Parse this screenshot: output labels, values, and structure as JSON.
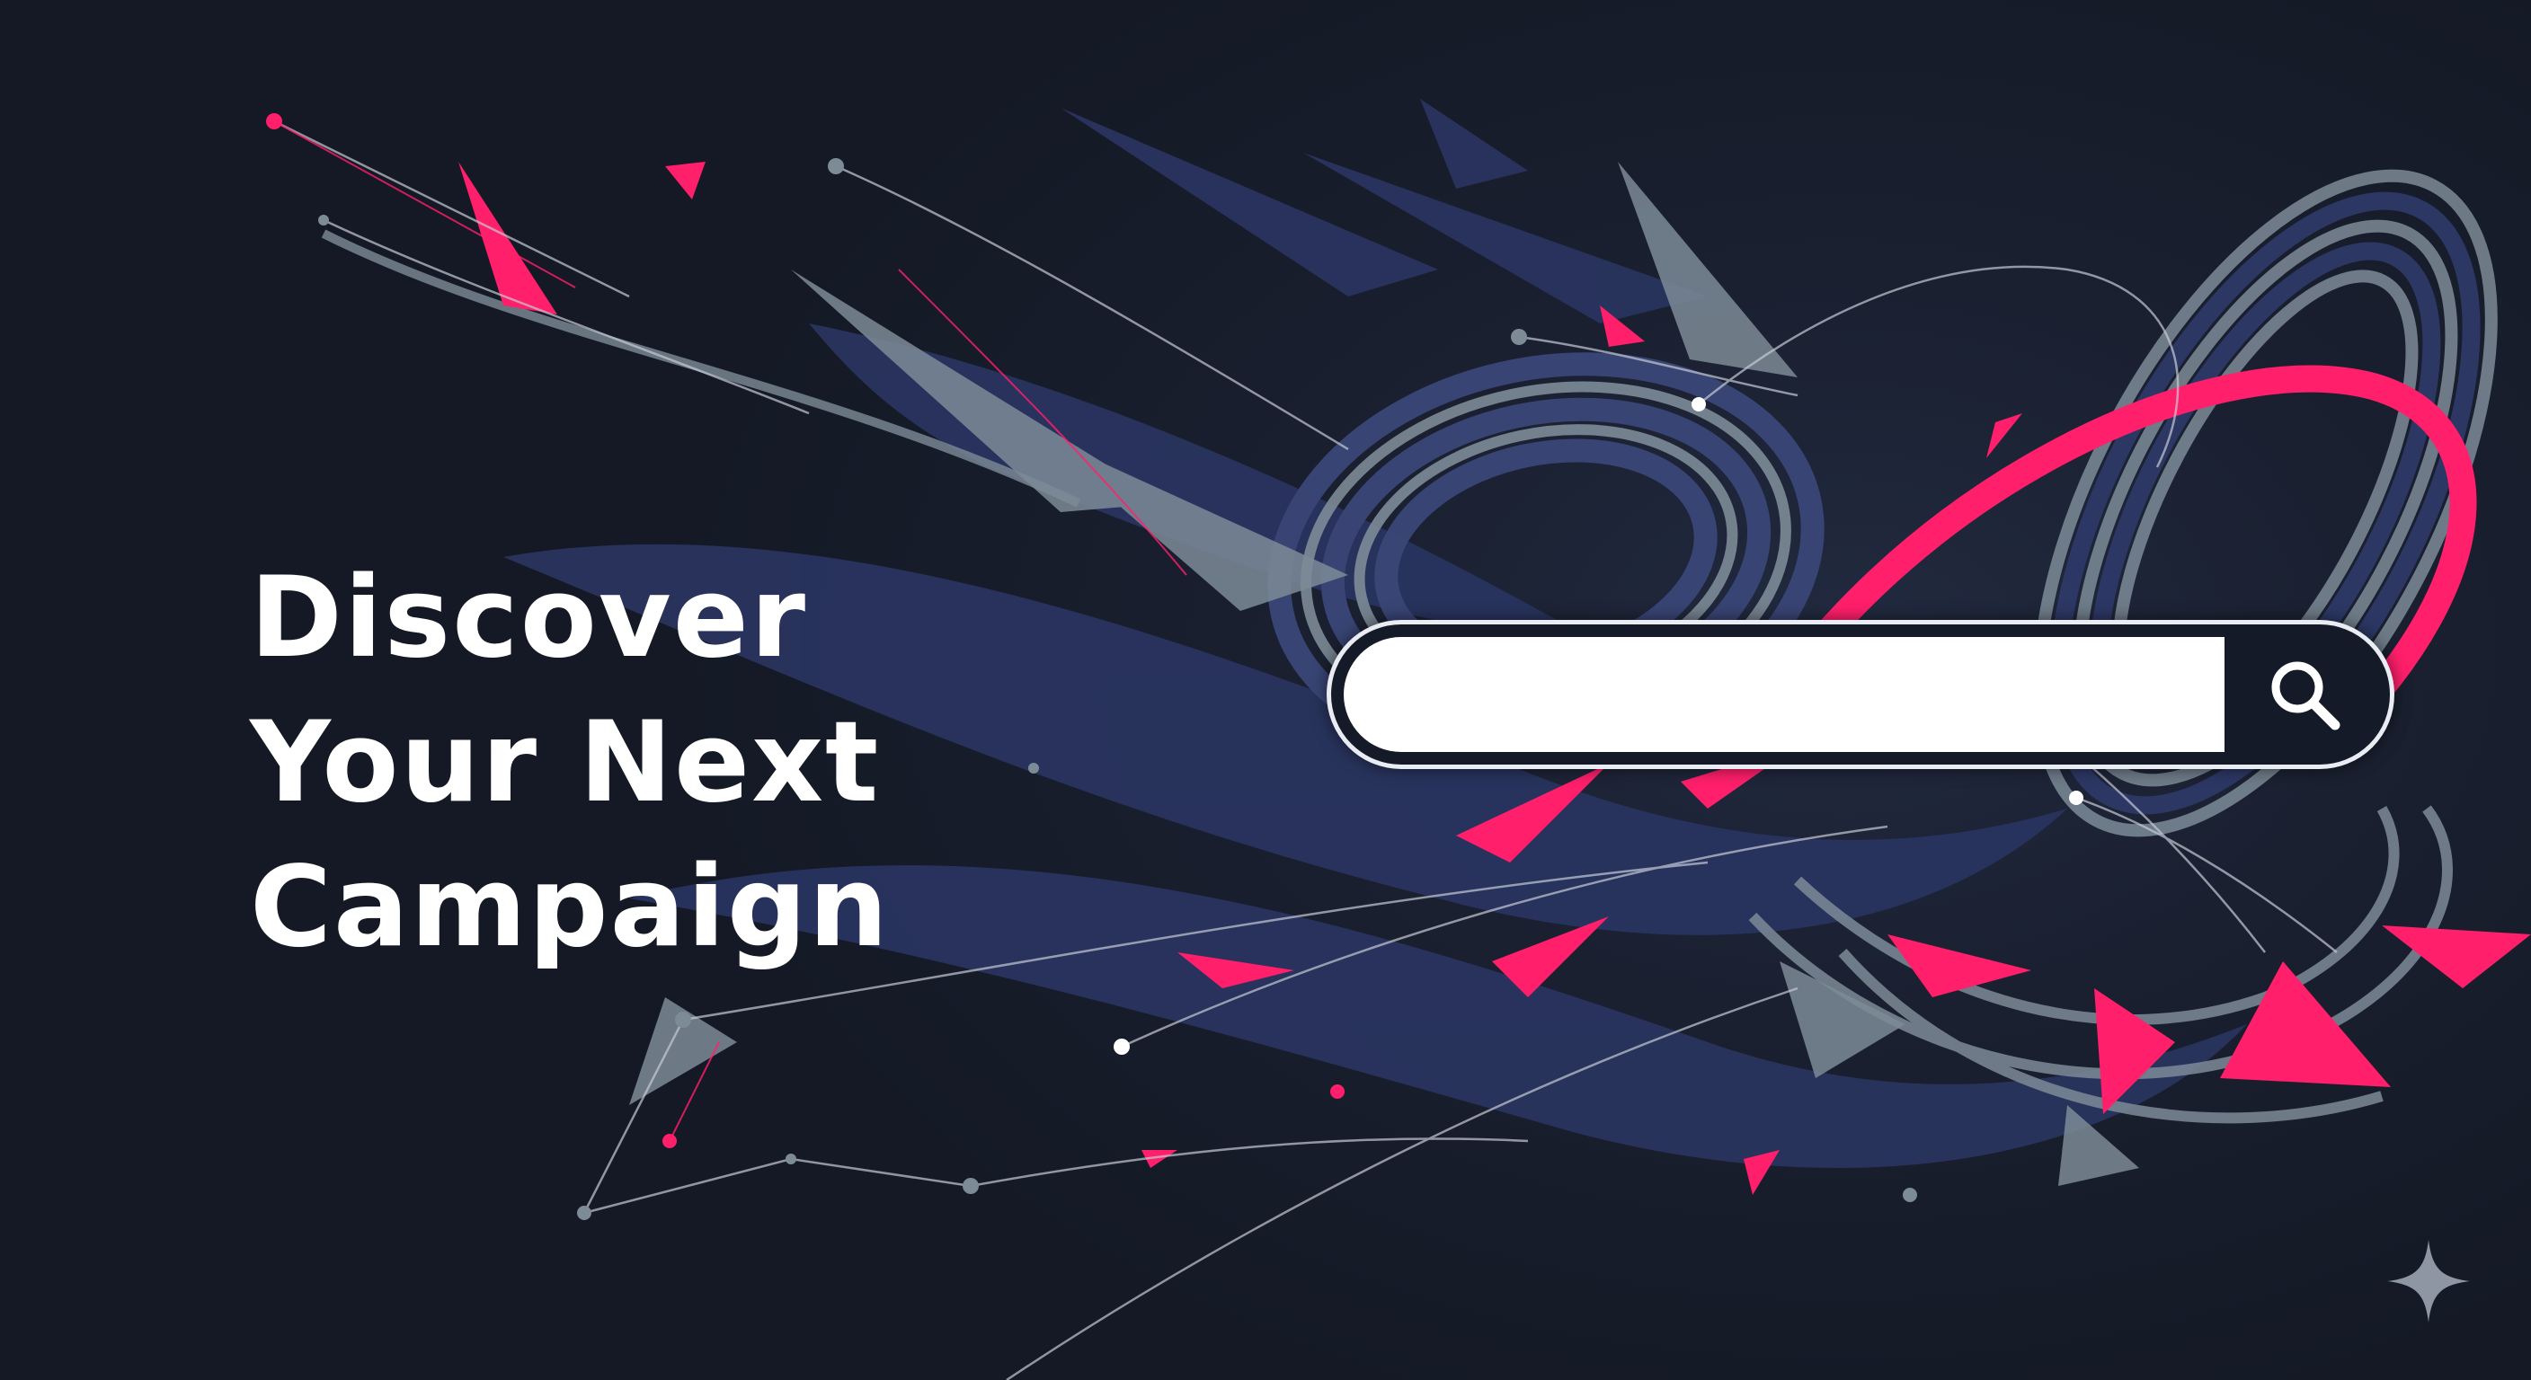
{
  "hero": {
    "headline_lines": [
      "Discover",
      "Your Next",
      "Campaign"
    ]
  },
  "search": {
    "placeholder": "",
    "value": "",
    "button_icon": "search-icon"
  },
  "decoration": {
    "corner_icon": "sparkle-icon"
  },
  "colors": {
    "background": "#161b27",
    "navy": "#2a3562",
    "slate": "#7d8b97",
    "pink": "#ff1f6b",
    "text": "#ffffff"
  }
}
